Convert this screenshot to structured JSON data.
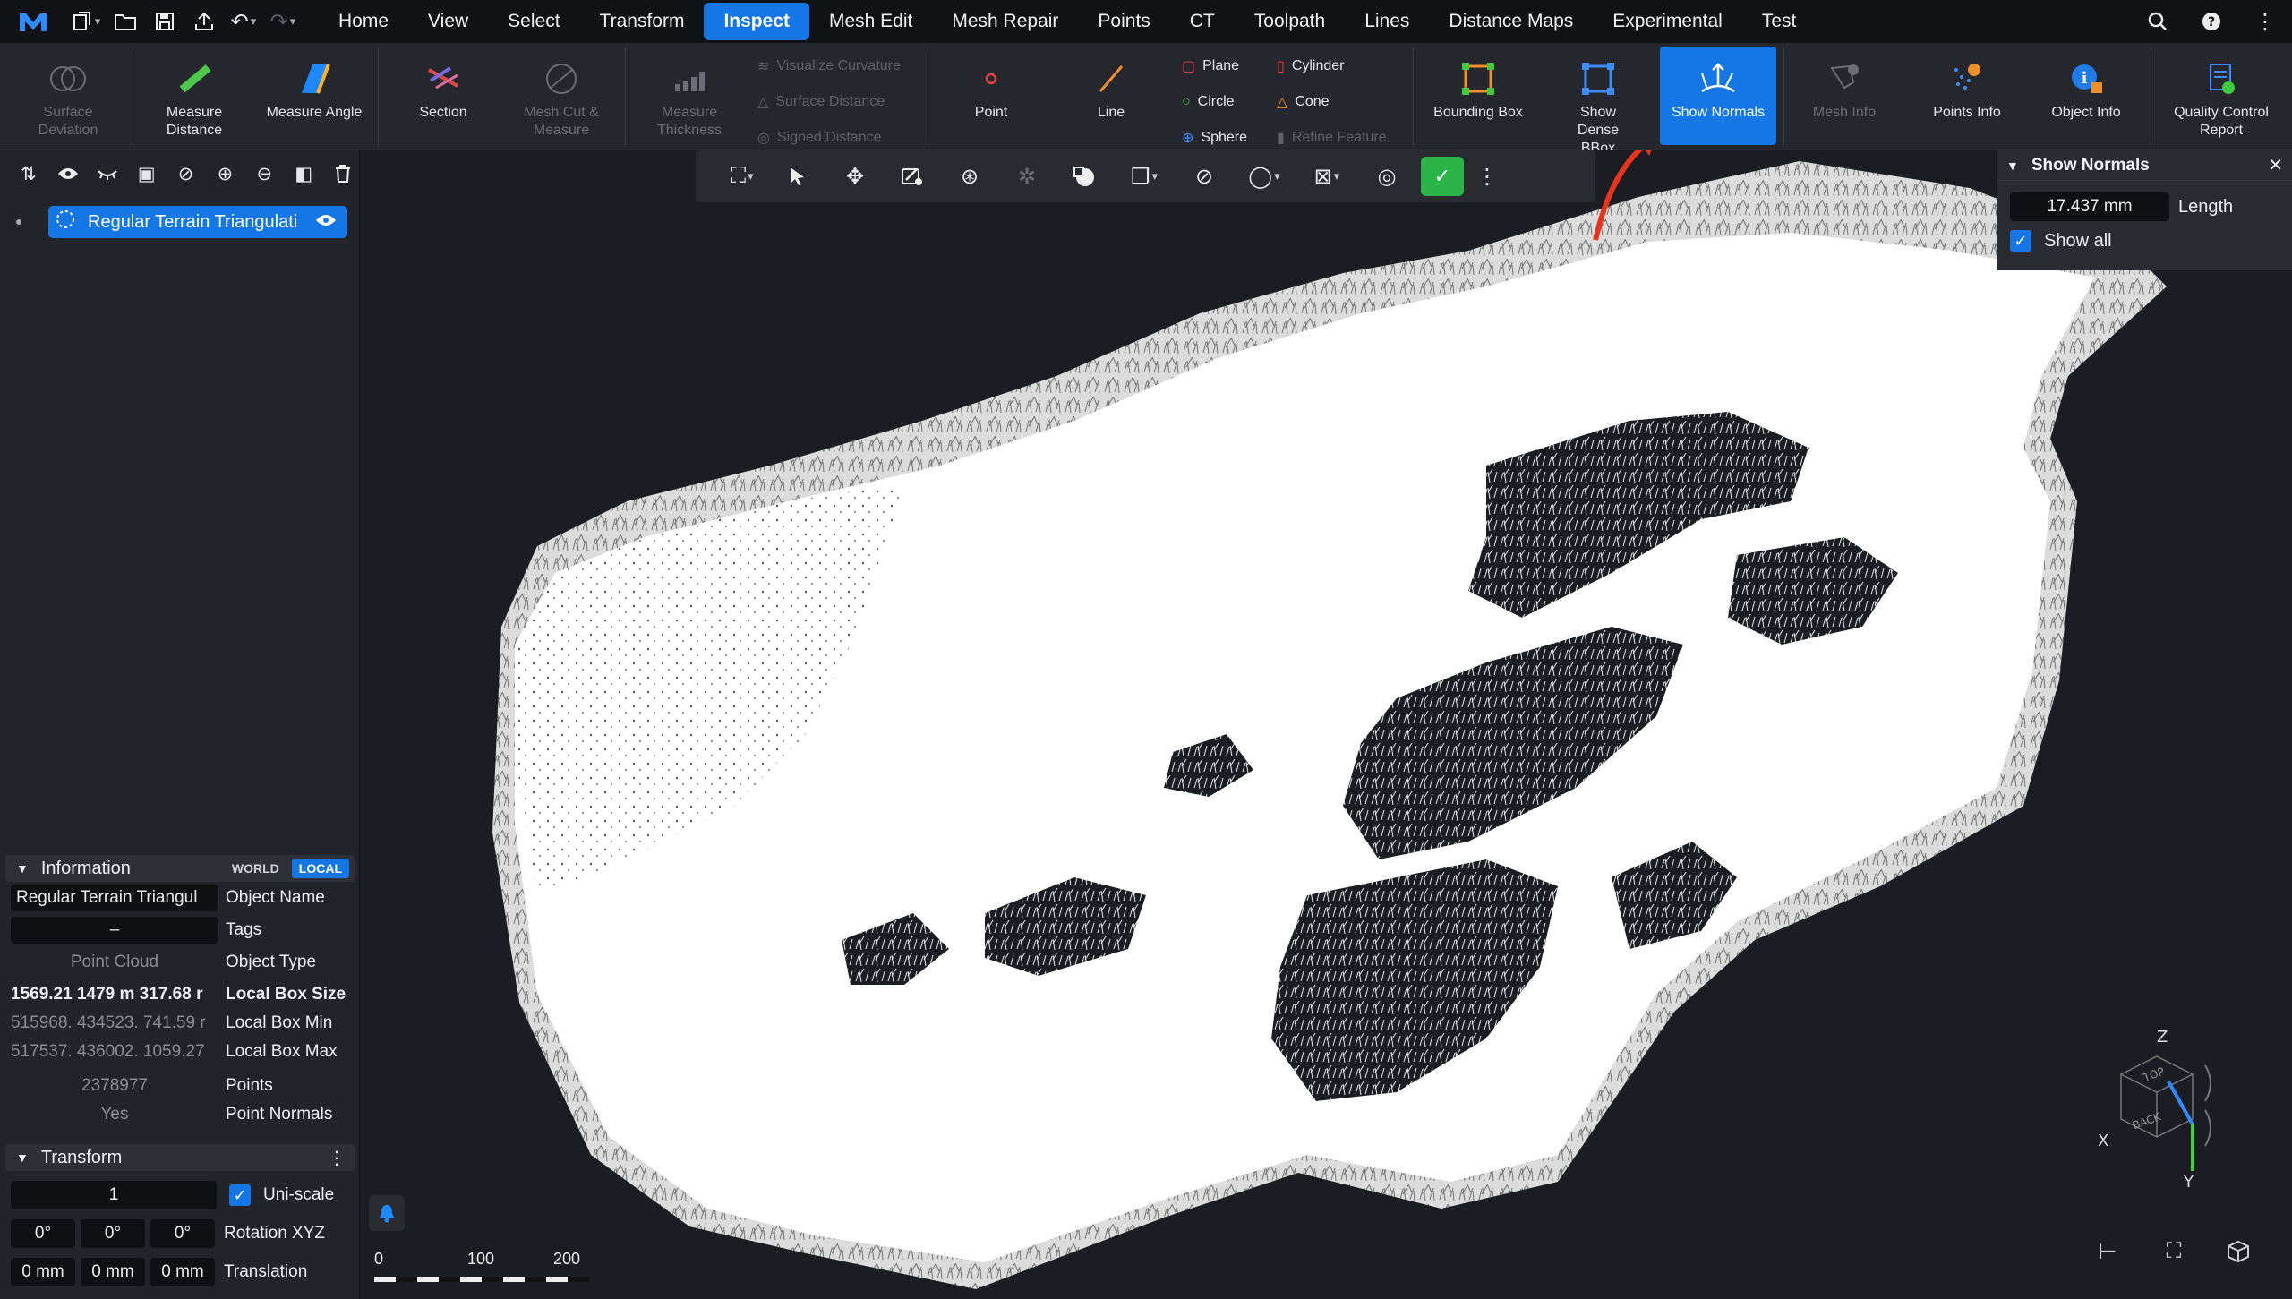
{
  "menubar": {
    "tabs": [
      "Home",
      "View",
      "Select",
      "Transform",
      "Inspect",
      "Mesh Edit",
      "Mesh Repair",
      "Points",
      "CT",
      "Toolpath",
      "Lines",
      "Distance Maps",
      "Experimental",
      "Test"
    ],
    "active_tab": "Inspect"
  },
  "ribbon": {
    "surface_deviation": "Surface Deviation",
    "measure_distance": "Measure Distance",
    "measure_angle": "Measure Angle",
    "section": "Section",
    "mesh_cut": "Mesh Cut & Measure",
    "measure_thickness": "Measure Thickness",
    "visualize_curvature": "Visualize Curvature",
    "surface_distance": "Surface Distance",
    "signed_distance": "Signed Distance",
    "point": "Point",
    "line": "Line",
    "plane": "Plane",
    "circle": "Circle",
    "sphere": "Sphere",
    "cylinder": "Cylinder",
    "cone": "Cone",
    "refine_feature": "Refine Feature",
    "bounding_box": "Bounding Box",
    "show_dense_bbox": "Show Dense BBox",
    "show_normals": "Show Normals",
    "mesh_info": "Mesh Info",
    "points_info": "Points Info",
    "object_info": "Object Info",
    "quality_report": "Quality Control Report"
  },
  "scene_tree": {
    "item_label": "Regular Terrain Triangulati"
  },
  "information": {
    "title": "Information",
    "world": "WORLD",
    "local": "LOCAL",
    "object_name_value": "Regular Terrain Triangul",
    "object_name_label": "Object Name",
    "tags_value": "–",
    "tags_label": "Tags",
    "object_type_value": "Point Cloud",
    "object_type_label": "Object Type",
    "box_size_value": "1569.21  1479 m  317.68 r",
    "box_size_label": "Local Box Size",
    "box_min_value": "515968.  434523.  741.59 r",
    "box_min_label": "Local Box Min",
    "box_max_value": "517537.  436002.  1059.27",
    "box_max_label": "Local Box Max",
    "points_value": "2378977",
    "points_label": "Points",
    "normals_value": "Yes",
    "normals_label": "Point Normals"
  },
  "transform": {
    "title": "Transform",
    "scale_value": "1",
    "uniscale_label": "Uni-scale",
    "rot_x": "0°",
    "rot_y": "0°",
    "rot_z": "0°",
    "rotation_label": "Rotation XYZ",
    "tr_x": "0 mm",
    "tr_y": "0 mm",
    "tr_z": "0 mm",
    "translation_label": "Translation"
  },
  "normals_panel": {
    "title": "Show Normals",
    "length_value": "17.437 mm",
    "length_label": "Length",
    "show_all_label": "Show all",
    "show_all_checked": true
  },
  "scale_bar": {
    "labels": [
      "0",
      "100",
      "200"
    ]
  },
  "axes": {
    "z": "Z",
    "x": "X",
    "y": "Y",
    "top": "TOP",
    "back": "BACK"
  },
  "colors": {
    "accent": "#1577e6",
    "annotation_arrow": "#e8341c",
    "green_toggle": "#2bb549"
  }
}
